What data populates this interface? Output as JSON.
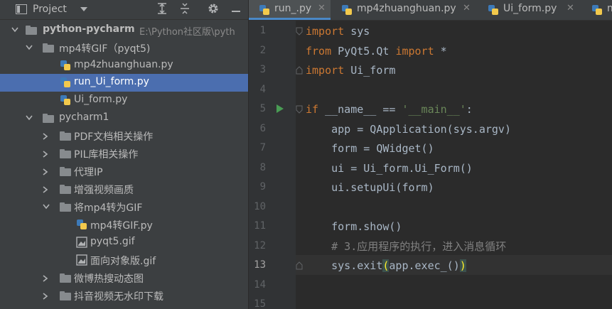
{
  "project_panel": {
    "title": "Project",
    "dropdown_icon": "chevron-down-icon",
    "tools": [
      "expand-all-icon",
      "collapse-all-icon",
      "gear-icon",
      "minimize-icon"
    ],
    "tree": [
      {
        "label": "python-pycharm",
        "hint": "E:\\Python社区版\\pyth",
        "kind": "folder",
        "expanded": true,
        "bold": true
      },
      {
        "label": "mp4转GIF（pyqt5)",
        "kind": "folder",
        "expanded": true
      },
      {
        "label": "mp4zhuanghuan.py",
        "kind": "py"
      },
      {
        "label": "run_Ui_form.py",
        "kind": "py",
        "selected": true
      },
      {
        "label": "Ui_form.py",
        "kind": "py"
      },
      {
        "label": "pycharm1",
        "kind": "folder",
        "expanded": true
      },
      {
        "label": "PDF文档相关操作",
        "kind": "folder",
        "expanded": false
      },
      {
        "label": "PIL库相关操作",
        "kind": "folder",
        "expanded": false
      },
      {
        "label": "代理IP",
        "kind": "folder",
        "expanded": false
      },
      {
        "label": "增强视频画质",
        "kind": "folder",
        "expanded": false
      },
      {
        "label": "将mp4转为GIF",
        "kind": "folder",
        "expanded": true
      },
      {
        "label": "mp4转GIF.py",
        "kind": "py"
      },
      {
        "label": "pyqt5.gif",
        "kind": "gif"
      },
      {
        "label": "面向对象版.gif",
        "kind": "gif"
      },
      {
        "label": "微博热搜动态图",
        "kind": "folder",
        "expanded": false
      },
      {
        "label": "抖音视频无水印下载",
        "kind": "folder",
        "expanded": false
      }
    ]
  },
  "editor": {
    "tabs": [
      {
        "label": "run_.py",
        "active": true
      },
      {
        "label": "mp4zhuanghuan.py",
        "active": false
      },
      {
        "label": "Ui_form.py",
        "active": false
      },
      {
        "label": "m",
        "active": false
      }
    ],
    "line_numbers": [
      "1",
      "2",
      "3",
      "4",
      "5",
      "6",
      "7",
      "8",
      "9",
      "10",
      "11",
      "12",
      "13",
      "14",
      "15"
    ],
    "current_line": "13",
    "code": {
      "l1_kw": "import",
      "l1_rest": " sys",
      "l2_kw1": "from",
      "l2_mid": " PyQt5.Qt ",
      "l2_kw2": "import",
      "l2_rest": " *",
      "l3_kw": "import",
      "l3_rest": " Ui_form",
      "l5_kw": "if",
      "l5_mid": " __name__ == ",
      "l5_str": "'__main__'",
      "l5_end": ":",
      "l6": "    app = QApplication(sys.argv)",
      "l7": "    form = QWidget()",
      "l8": "    ui = Ui_form.Ui_Form()",
      "l9": "    ui.setupUi(form)",
      "l11": "    form.show()",
      "l12": "    # 3.应用程序的执行，进入消息循环",
      "l13_a": "    sys.exit",
      "l13_b": "(",
      "l13_c": "app.exec_()",
      "l13_d": ")"
    },
    "run_icon": "run-icon"
  },
  "colors": {
    "keyword": "#cc7832",
    "string": "#6a8759",
    "comment": "#808080",
    "selection": "#4b6eaf",
    "tab_accent": "#4a88c7"
  }
}
